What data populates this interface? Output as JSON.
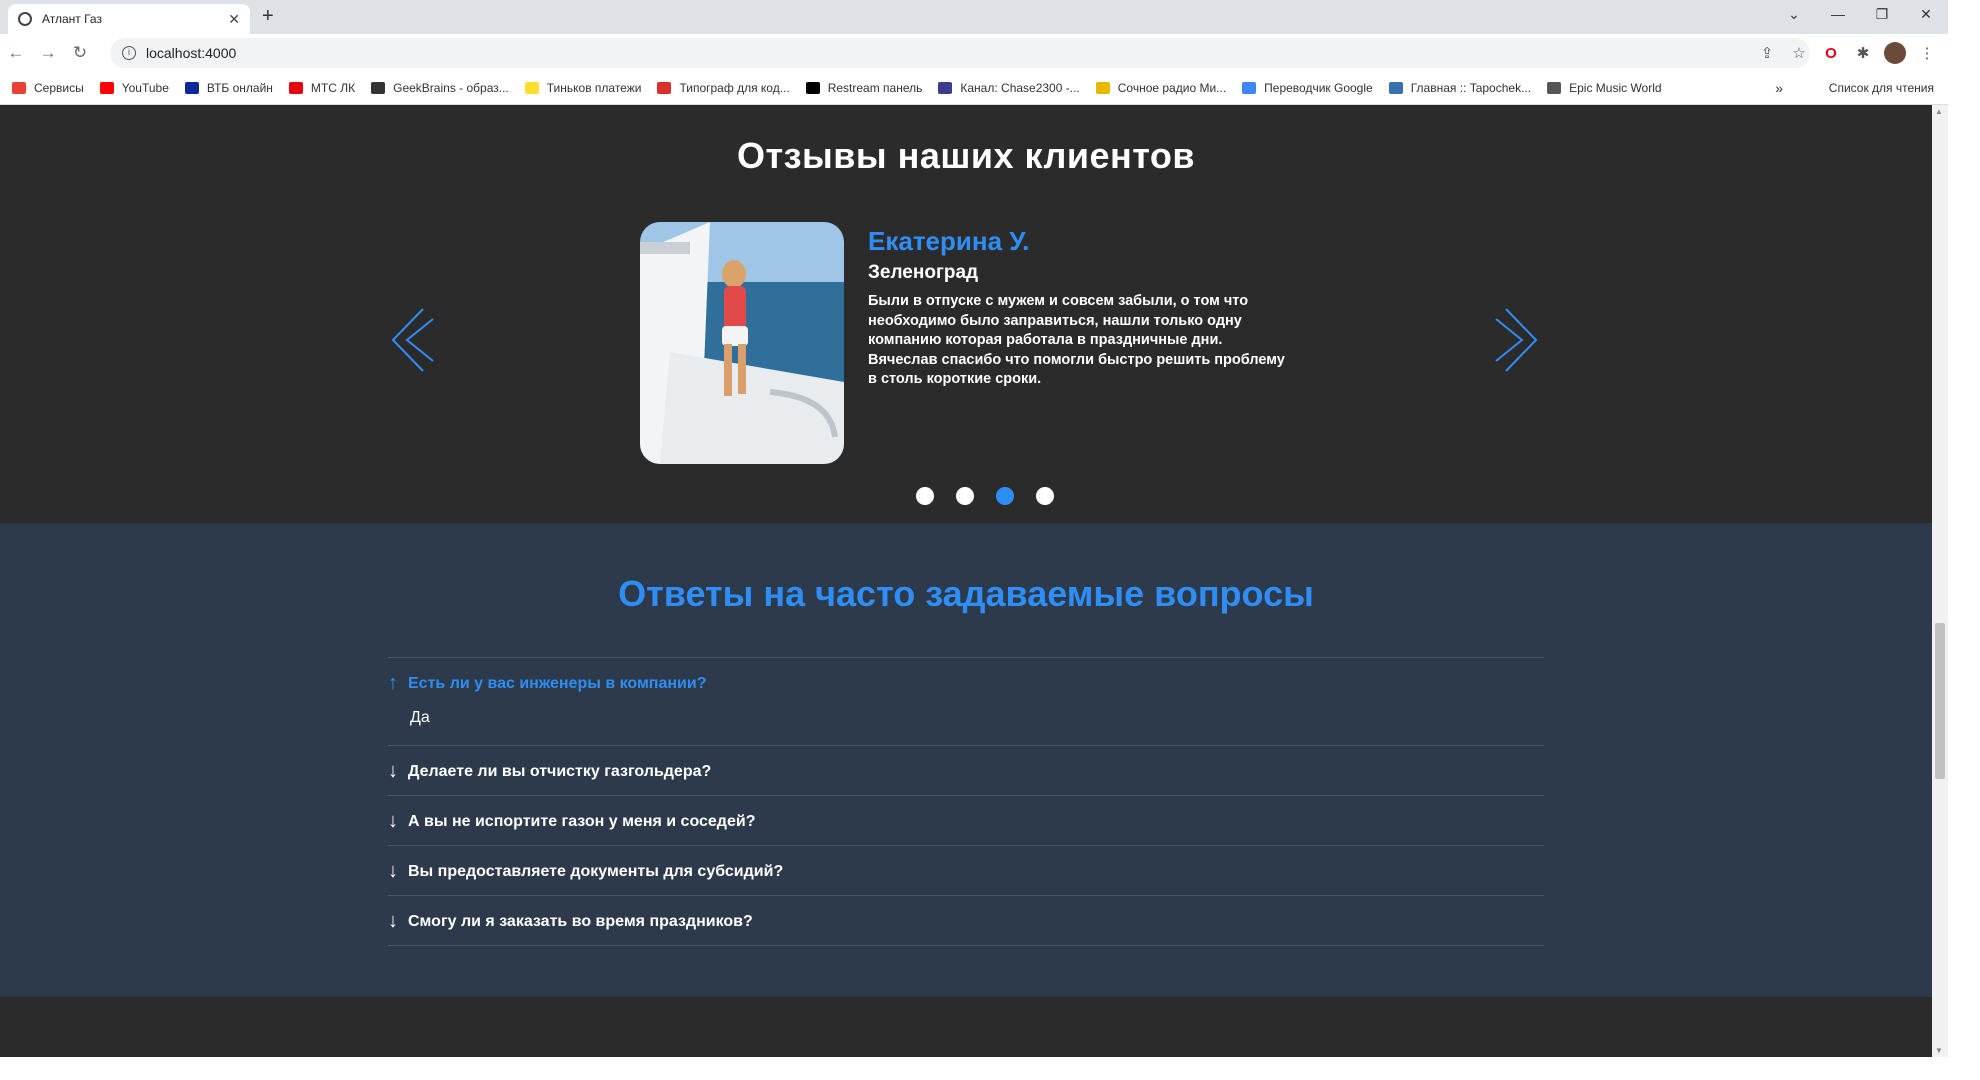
{
  "browser": {
    "tab_title": "Атлант Газ",
    "tab_close": "✕",
    "new_tab": "+",
    "url": "localhost:4000",
    "window_controls": [
      "⌄",
      "—",
      "❐",
      "✕"
    ],
    "bookmarks": [
      {
        "label": "Сервисы",
        "color": "#e94235"
      },
      {
        "label": "YouTube",
        "color": "#ff0000"
      },
      {
        "label": "ВТБ онлайн",
        "color": "#0a2896"
      },
      {
        "label": "МТС ЛК",
        "color": "#e30611"
      },
      {
        "label": "GeekBrains - образ...",
        "color": "#333333"
      },
      {
        "label": "Тиньков платежи",
        "color": "#ffdd2d"
      },
      {
        "label": "Типограф для код...",
        "color": "#d9302c"
      },
      {
        "label": "Restream панель",
        "color": "#000000"
      },
      {
        "label": "Канал: Chase2300 -...",
        "color": "#3b3b8f"
      },
      {
        "label": "Сочное радио Ми...",
        "color": "#e9b800"
      },
      {
        "label": "Переводчик Google",
        "color": "#4285f4"
      },
      {
        "label": "Главная :: Tapochek...",
        "color": "#3a6fb0"
      },
      {
        "label": "Epic Music World",
        "color": "#555555"
      }
    ],
    "bookmarks_more": "»",
    "reading_list": "Список для чтения"
  },
  "reviews": {
    "title": "Отзывы наших клиентов",
    "name": "Екатерина У.",
    "city": "Зеленоград",
    "text": "Были в отпуске с мужем и совсем забыли, о том что необходимо было заправиться, нашли только одну компанию которая работала в праздничные дни. Вячеслав спасибо что помогли быстро решить проблему в столь короткие сроки.",
    "slide_count": 4,
    "active_slide": 3,
    "accent": "#2f8ef5"
  },
  "faq": {
    "title": "Ответы на часто задаваемые вопросы",
    "items": [
      {
        "question": "Есть ли у вас инженеры в компании?",
        "answer": "Да",
        "open": true,
        "arrow": "↑"
      },
      {
        "question": "Делаете ли вы отчистку газгольдера?",
        "open": false,
        "arrow": "↓"
      },
      {
        "question": "А вы не испортите газон у меня и соседей?",
        "open": false,
        "arrow": "↓"
      },
      {
        "question": "Вы предоставляете документы для субсидий?",
        "open": false,
        "arrow": "↓"
      },
      {
        "question": "Смогу ли я заказать во время праздников?",
        "open": false,
        "arrow": "↓"
      }
    ]
  }
}
